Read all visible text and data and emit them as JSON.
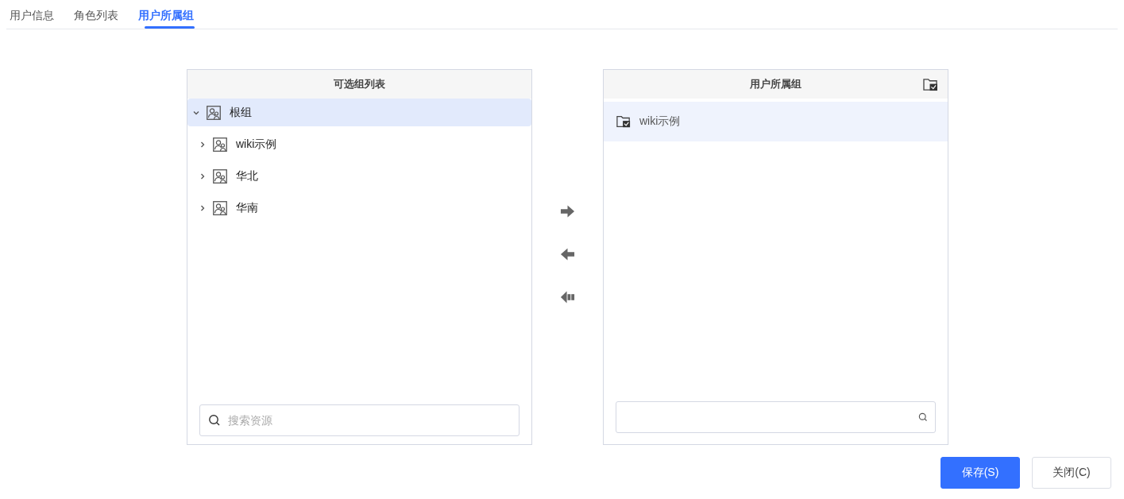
{
  "tabs": [
    {
      "label": "用户信息",
      "selected": false
    },
    {
      "label": "角色列表",
      "selected": false
    },
    {
      "label": "用户所属组",
      "selected": true
    }
  ],
  "available_panel": {
    "title": "可选组列表",
    "tree": [
      {
        "label": "根组",
        "expanded": true,
        "selected": true,
        "children": [
          {
            "label": "wiki示例",
            "expanded": false,
            "selected": false
          },
          {
            "label": "华北",
            "expanded": false,
            "selected": false
          },
          {
            "label": "华南",
            "expanded": false,
            "selected": false
          }
        ]
      }
    ],
    "search": {
      "placeholder": "搜索资源"
    }
  },
  "assigned_panel": {
    "title": "用户所属组",
    "items": [
      {
        "label": "wiki示例",
        "selected": true
      }
    ]
  },
  "buttons": [
    {
      "label": "保存(S)",
      "kind": "primary"
    },
    {
      "label": "关闭(C)",
      "kind": "default"
    }
  ]
}
